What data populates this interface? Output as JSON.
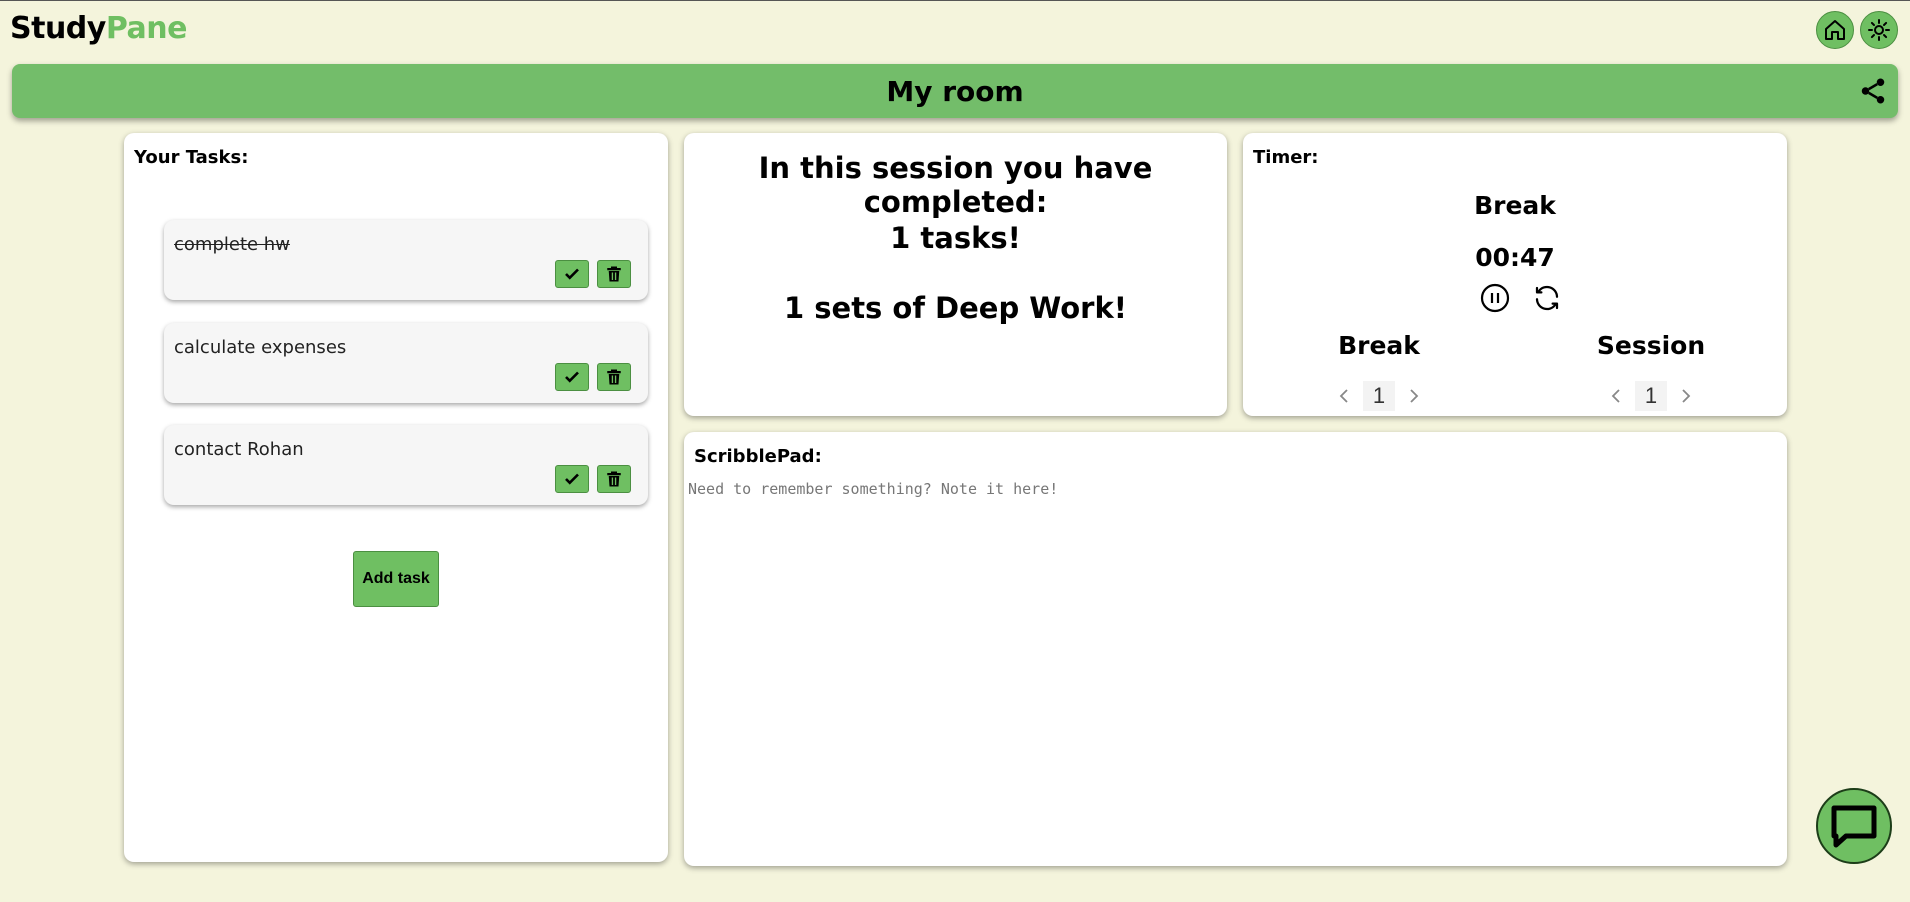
{
  "header": {
    "logo_study": "Study",
    "logo_pane": "Pane",
    "home_icon": "home-icon",
    "theme_icon": "sun-icon"
  },
  "room": {
    "title": "My room",
    "share_icon": "share-icon"
  },
  "tasks": {
    "label": "Your Tasks:",
    "items": [
      {
        "text": "complete hw",
        "done": true
      },
      {
        "text": "calculate expenses",
        "done": false
      },
      {
        "text": "contact Rohan",
        "done": false
      }
    ],
    "add_label": "Add task"
  },
  "summary": {
    "heading": "In this session you have completed:",
    "tasks_line": "1 tasks!",
    "deep_work_line": "1 sets of Deep Work!"
  },
  "timer": {
    "label": "Timer:",
    "mode": "Break",
    "time": "00:47",
    "break_label": "Break",
    "break_value": "1",
    "session_label": "Session",
    "session_value": "1"
  },
  "scribble": {
    "label": "ScribblePad:",
    "placeholder": "Need to remember something? Note it here!"
  },
  "colors": {
    "accent": "#6fbf62",
    "background": "#f4f4dc"
  }
}
